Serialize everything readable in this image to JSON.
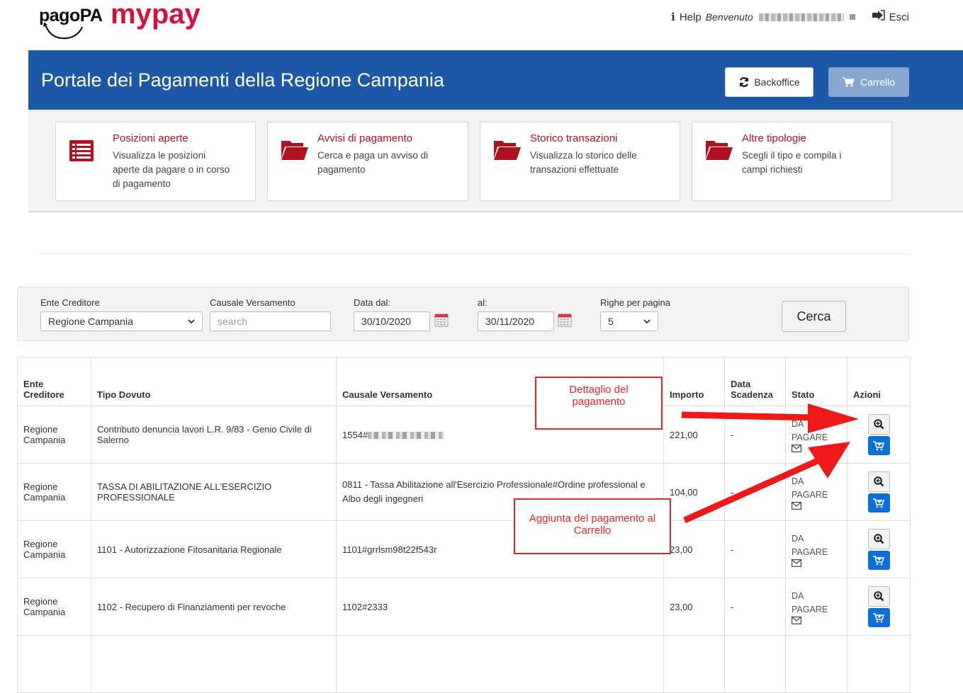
{
  "header": {
    "logo_pagopa": "pagoPA",
    "logo_mypay_my": "my",
    "logo_mypay_pay": "pay",
    "help_label": "Help",
    "welcome_label": "Benvenuto",
    "exit_label": "Esci",
    "portal_title": "Portale dei Pagamenti della Regione Campania",
    "backoffice_label": "Backoffice",
    "cart_label": "Carrello"
  },
  "menu": [
    {
      "title": "Posizioni aperte",
      "desc": "Visualizza le posizioni aperte da pagare o in corso di pagamento",
      "icon": "list-icon"
    },
    {
      "title": "Avvisi di pagamento",
      "desc": "Cerca e paga un avviso di pagamento",
      "icon": "folder-icon"
    },
    {
      "title": "Storico transazioni",
      "desc": "Visualizza lo storico delle transazioni effettuate",
      "icon": "folder-icon"
    },
    {
      "title": "Altre tipologie",
      "desc": "Scegli il tipo e compila i campi richiesti",
      "icon": "folder-icon"
    }
  ],
  "filters": {
    "ente_label": "Ente Creditore",
    "ente_value": "Regione Campania",
    "causale_label": "Causale Versamento",
    "causale_placeholder": "search",
    "data_dal_label": "Data dal:",
    "data_dal_value": "30/10/2020",
    "data_al_label": "al:",
    "data_al_value": "30/11/2020",
    "righe_label": "Righe per pagina",
    "righe_value": "5",
    "search_button": "Cerca"
  },
  "table": {
    "headers": {
      "ente": "Ente Creditore",
      "tipo": "Tipo Dovuto",
      "causale": "Causale Versamento",
      "importo": "Importo",
      "scadenza": "Data Scadenza",
      "stato": "Stato",
      "azioni": "Azioni"
    },
    "rows": [
      {
        "ente": "Regione Campania",
        "tipo": "Contributo denuncia lavori L.R. 9/83 - Genio Civile di Salerno",
        "causale": "1554#",
        "importo": "221,00",
        "scadenza": "-",
        "stato_1": "DA",
        "stato_2": "PAGARE"
      },
      {
        "ente": "Regione Campania",
        "tipo": "TASSA DI ABILITAZIONE ALL'ESERCIZIO PROFESSIONALE",
        "causale": "0811 - Tassa Abilitazione all'Esercizio Professionale#Ordine professional e Albo degli ingegneri",
        "importo": "104,00",
        "scadenza": "-",
        "stato_1": "DA",
        "stato_2": "PAGARE"
      },
      {
        "ente": "Regione Campania",
        "tipo": "1101 - Autorizzazione Fitosanitaria Regionale",
        "causale": "1101#grrlsm98t22f543r",
        "importo": "23,00",
        "scadenza": "-",
        "stato_1": "DA",
        "stato_2": "PAGARE"
      },
      {
        "ente": "Regione Campania",
        "tipo": "1102 - Recupero di Finanziamenti per revoche",
        "causale": "1102#2333",
        "importo": "23,00",
        "scadenza": "-",
        "stato_1": "DA",
        "stato_2": "PAGARE"
      }
    ]
  },
  "annotations": {
    "detail": "Dettaglio del pagamento",
    "add_to_cart": "Aggiunta del pagamento al Carrello"
  },
  "colors": {
    "band_blue": "#1d58a7",
    "brand_red": "#d1143c",
    "menu_red": "#b0131f",
    "annotation_red": "#e8232a",
    "action_blue": "#0a6fd8"
  }
}
